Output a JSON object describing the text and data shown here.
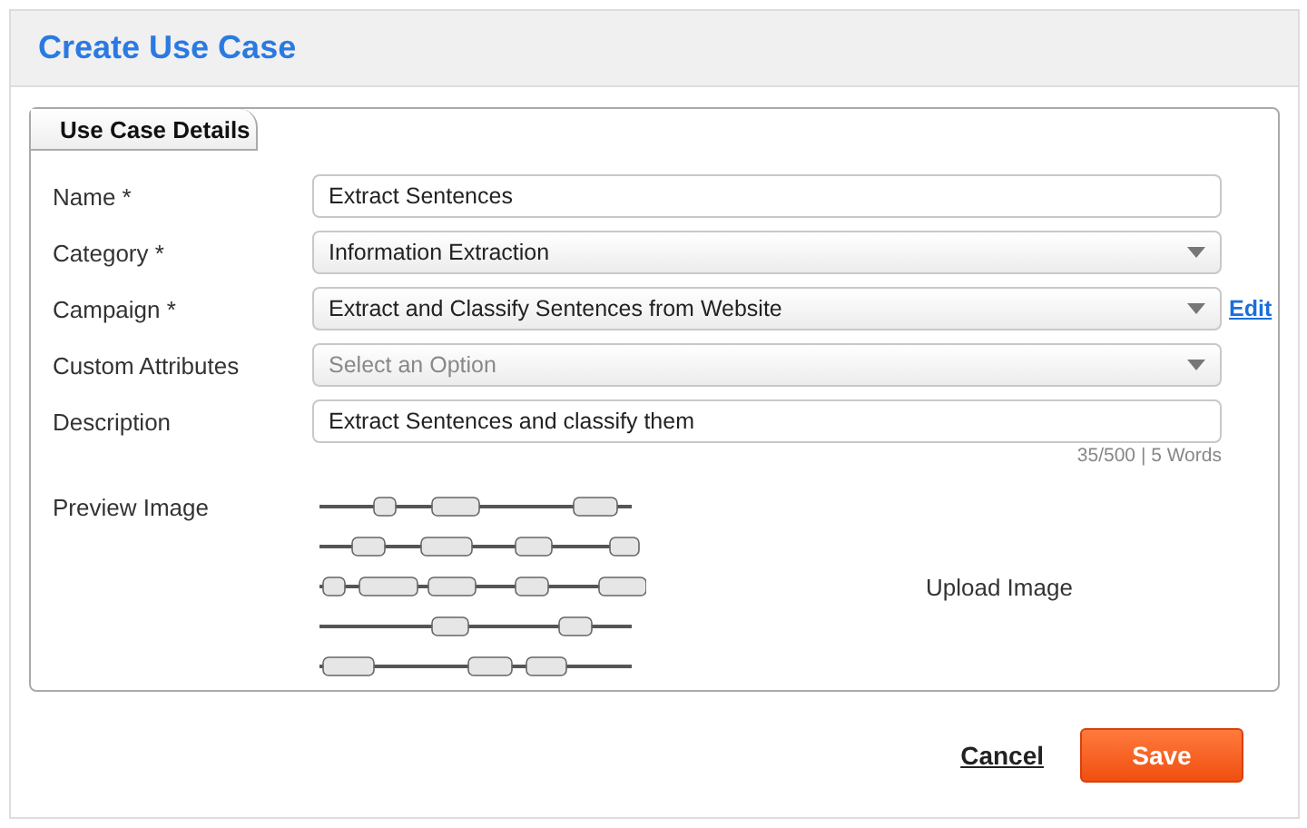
{
  "window": {
    "title": "Create Use Case"
  },
  "tab": {
    "label": "Use Case Details"
  },
  "fields": [
    {
      "kind": "text",
      "label": "Name *",
      "value": "Extract Sentences"
    },
    {
      "kind": "select",
      "label": "Category *",
      "value": "Information Extraction"
    },
    {
      "kind": "select",
      "label": "Campaign *",
      "value": "Extract and Classify Sentences from Website",
      "link": "Edit"
    },
    {
      "kind": "select",
      "label": "Custom Attributes",
      "placeholder": "Select an Option"
    },
    {
      "kind": "text",
      "label": "Description",
      "value": "Extract Sentences and classify them",
      "counter": "35/500 | 5 Words"
    }
  ],
  "preview": {
    "label": "Preview Image",
    "upload": "Upload Image"
  },
  "buttons": [
    {
      "kind": "link",
      "label": "Cancel"
    },
    {
      "kind": "primary",
      "label": "Save"
    }
  ]
}
